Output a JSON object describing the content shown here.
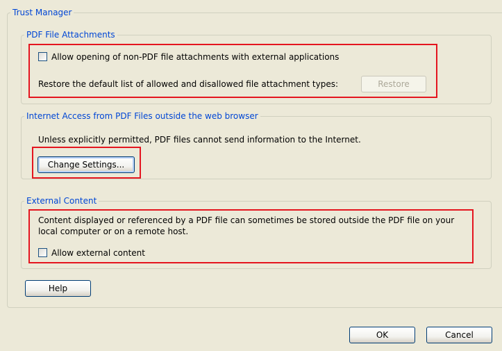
{
  "trust_manager": {
    "title": "Trust Manager"
  },
  "pdf_attachments": {
    "legend": "PDF File Attachments",
    "allow_label": "Allow opening of non-PDF file attachments with external applications",
    "allow_checked": false,
    "restore_text": "Restore the default list of allowed and disallowed file attachment types:",
    "restore_button": "Restore",
    "restore_enabled": false
  },
  "internet_access": {
    "legend": "Internet Access from PDF Files outside the web browser",
    "description": "Unless explicitly permitted, PDF files cannot send information to the Internet.",
    "change_settings_button": "Change Settings..."
  },
  "external_content": {
    "legend": "External Content",
    "description_line1": "Content displayed or referenced by a PDF file can sometimes be stored outside the PDF file on your",
    "description_line2": "local computer or on a remote host.",
    "allow_label": "Allow external content",
    "allow_checked": false
  },
  "footer": {
    "help_button": "Help",
    "ok_button": "OK",
    "cancel_button": "Cancel"
  },
  "colors": {
    "dialog_background": "#ece9d8",
    "legend_text": "#0046d5",
    "highlight_border": "#e4151f",
    "groupbox_border": "#d0d0bf"
  }
}
